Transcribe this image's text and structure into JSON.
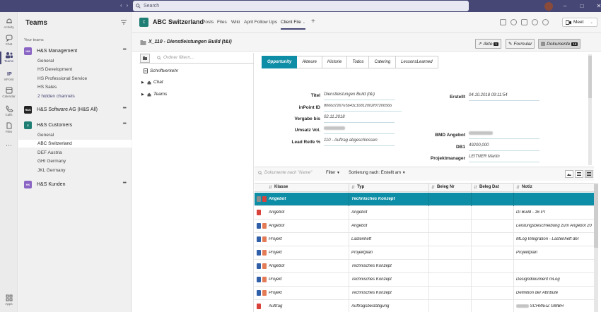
{
  "titlebar": {
    "search_placeholder": "Search",
    "meet_label": "Meet"
  },
  "rail": [
    {
      "label": "Activity",
      "icon": "bell-icon"
    },
    {
      "label": "Chat",
      "icon": "chat-icon"
    },
    {
      "label": "Teams",
      "icon": "teams-icon"
    },
    {
      "label": "inPoint",
      "icon": "inpoint-icon"
    },
    {
      "label": "Calendar",
      "icon": "calendar-icon"
    },
    {
      "label": "Calls",
      "icon": "phone-icon"
    },
    {
      "label": "Files",
      "icon": "file-icon"
    },
    {
      "label": "Apps",
      "icon": "apps-icon"
    }
  ],
  "teams": {
    "title": "Teams",
    "your_teams": "Your teams",
    "list": [
      {
        "initials": "HM",
        "name": "H&S Management",
        "color": "#8a64c4"
      },
      {
        "initials": "H&S",
        "name": "H&S Software AG (H&S All)",
        "color": "#222222"
      },
      {
        "initials": "C",
        "name": "H&S Customers",
        "color": "#1f7e74"
      },
      {
        "initials": "HK",
        "name": "H&S Kunden",
        "color": "#8a64c4"
      }
    ],
    "channels_mgmt": [
      "General",
      "HS Development",
      "HS Professional Service",
      "HS Sales",
      "2 hidden channels"
    ],
    "channels_cust": [
      "General",
      "ABC Switzerland",
      "DEF Austria",
      "GHI Germany",
      "JKL Germany"
    ]
  },
  "channel": {
    "avatar": "C",
    "title": "ABC Switzerland",
    "tabs": [
      "Posts",
      "Files",
      "Wiki",
      "April Follow Ups",
      "Client File"
    ]
  },
  "doc": {
    "title": "X_110 - Dienstleistungen Build (t&i)",
    "akte_label": "Akte",
    "akte_count": "1",
    "formular_label": "Formular",
    "dokumente_label": "Dokumente",
    "dokumente_count": "16"
  },
  "tree": {
    "filter_placeholder": "Ordner filtern...",
    "items": [
      "Schriftverkehr",
      "Chat",
      "Teams"
    ]
  },
  "meta": {
    "tabs": [
      "Opportunity",
      "Akteure",
      "Historie",
      "Todos",
      "Catering",
      "LessonsLearned"
    ],
    "left_fields": [
      {
        "label": "Titel",
        "value": "Dienstleistungen Build (t&i)"
      },
      {
        "label": "inPoint ID",
        "value": "8066d7267e5b43c16812002f0720656b"
      },
      {
        "label": "Vergabe bis",
        "value": "02.11.2018"
      },
      {
        "label": "Umsatz Vol.",
        "value": ""
      },
      {
        "label": "Lead Reife %",
        "value": "110 - Auftrag abgeschlossen"
      }
    ],
    "right_fields": [
      {
        "label": "Erstellt",
        "value": "04.10.2018 09:11:54"
      },
      {
        "label": "BMD Angebot",
        "value": ""
      },
      {
        "label": "DB1",
        "value": "49200,000"
      },
      {
        "label": "Projektmanager",
        "value": "LEITNER Martin"
      }
    ]
  },
  "files": {
    "search_placeholder": "Dokumente nach \"Name\"",
    "filter_label": "Filter",
    "sort_label": "Sortierung nach: Erstellt am",
    "columns": [
      "Klasse",
      "Typ",
      "Beleg Nr",
      "Beleg Dat",
      "Notiz"
    ],
    "rows": [
      {
        "klasse": "Angebot",
        "typ": "Technisches Konzept",
        "notiz": "",
        "icon": "pdf-icon"
      },
      {
        "klasse": "Angebot",
        "typ": "Angebot",
        "notiz": "DI Build - 16 PT",
        "icon": "pdf-icon"
      },
      {
        "klasse": "Angebot",
        "typ": "Angebot",
        "notiz": "Leistungsbeschreibung zum Angebot 20",
        "icon": "doc-icon"
      },
      {
        "klasse": "Projekt",
        "typ": "Lastenheft",
        "notiz": "MLog Integration - Lastenheft der",
        "icon": "doc-icon"
      },
      {
        "klasse": "Projekt",
        "typ": "Projektplan",
        "notiz": "Projektplan",
        "icon": "doc-icon"
      },
      {
        "klasse": "Angebot",
        "typ": "Technisches Konzept",
        "notiz": "",
        "icon": "doc-icon"
      },
      {
        "klasse": "Projekt",
        "typ": "Technisches Konzept",
        "notiz": "Designdokument mLog",
        "icon": "doc-icon"
      },
      {
        "klasse": "Projekt",
        "typ": "Technisches Konzept",
        "notiz": "Definition der Attribute",
        "icon": "doc-icon"
      },
      {
        "klasse": "Auftrag",
        "typ": "Auftragsbestätigung",
        "notiz": "SCHWEIZ GMBH",
        "icon": "pdf-icon"
      }
    ]
  },
  "colors": {
    "titlebar": "#464775",
    "accent": "#0e8ea6",
    "rail_active": "#464775"
  }
}
